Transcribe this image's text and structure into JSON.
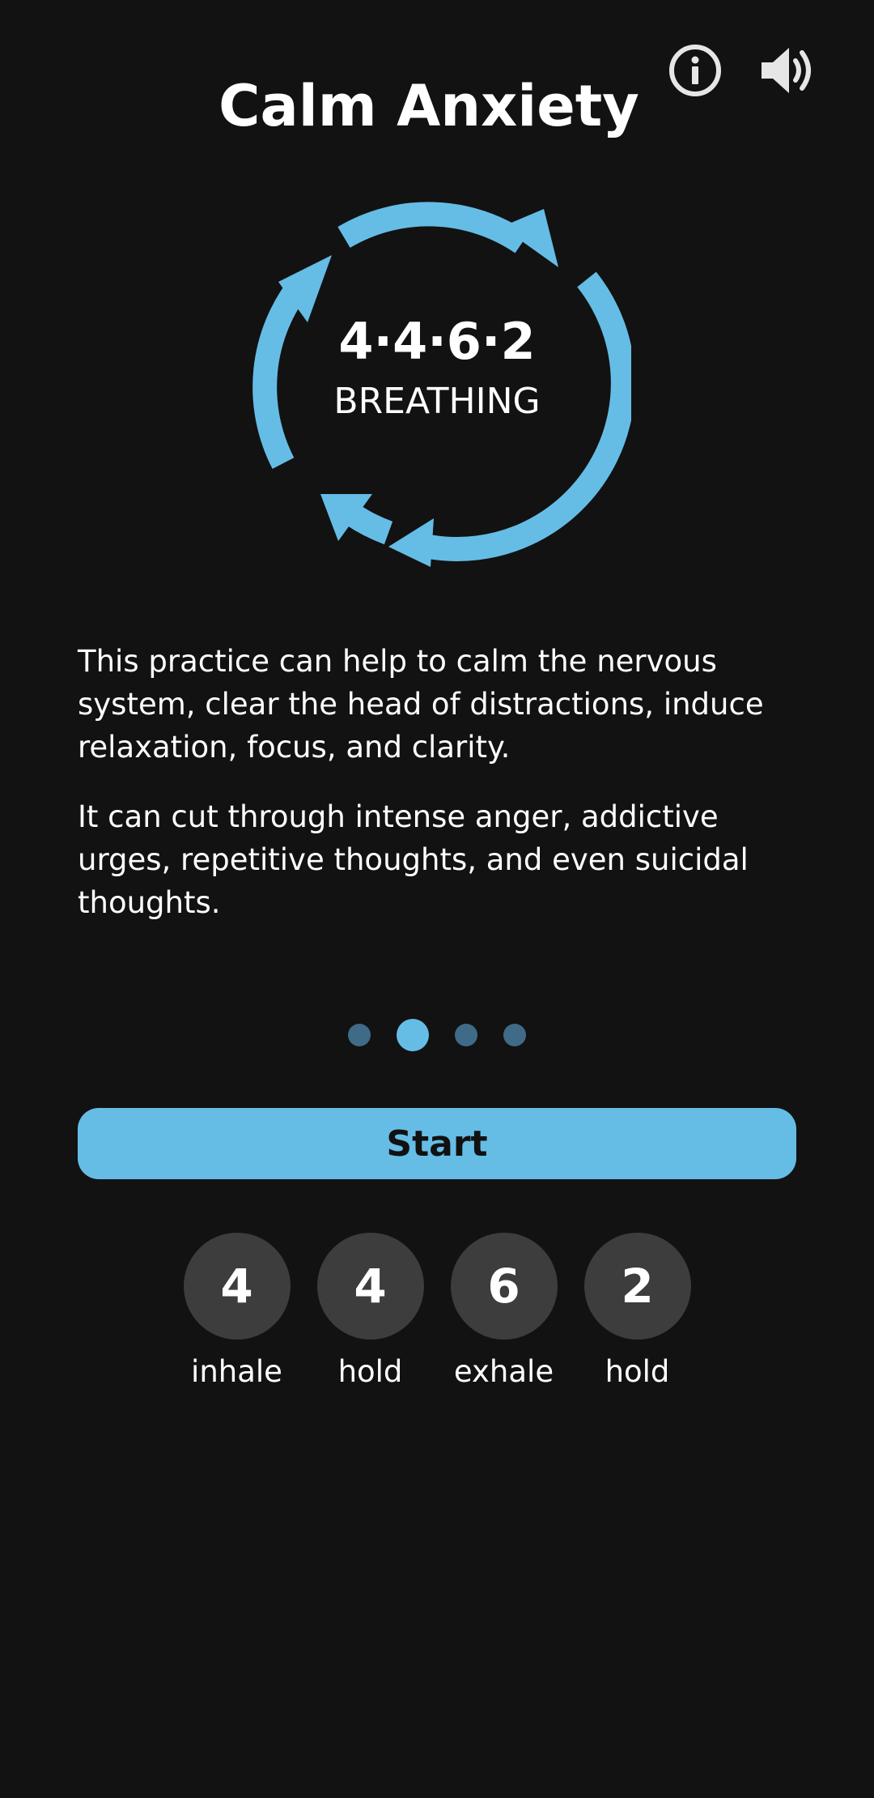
{
  "header": {
    "title": "Calm Anxiety",
    "info_icon": "info-circle-icon",
    "sound_icon": "speaker-volume-icon"
  },
  "logo": {
    "number": "4·4·6·2",
    "word": "BREATHING",
    "arrow_color": "#65bde6"
  },
  "description": {
    "paragraph_1": "This practice can help to calm the nervous system, clear the head of distractions, induce relaxation, focus, and clarity.",
    "paragraph_2": "It can cut through intense anger, addictive urges, repetitive thoughts, and even suicidal thoughts."
  },
  "pagination": {
    "total": 4,
    "active_index": 1
  },
  "start_button": {
    "label": "Start"
  },
  "steps": [
    {
      "value": "4",
      "label": "inhale"
    },
    {
      "value": "4",
      "label": "hold"
    },
    {
      "value": "6",
      "label": "exhale"
    },
    {
      "value": "2",
      "label": "hold"
    }
  ],
  "colors": {
    "background": "#121212",
    "accent": "#65bde6",
    "dot_inactive": "#3f6b88",
    "step_circle": "#3d3d3d"
  }
}
